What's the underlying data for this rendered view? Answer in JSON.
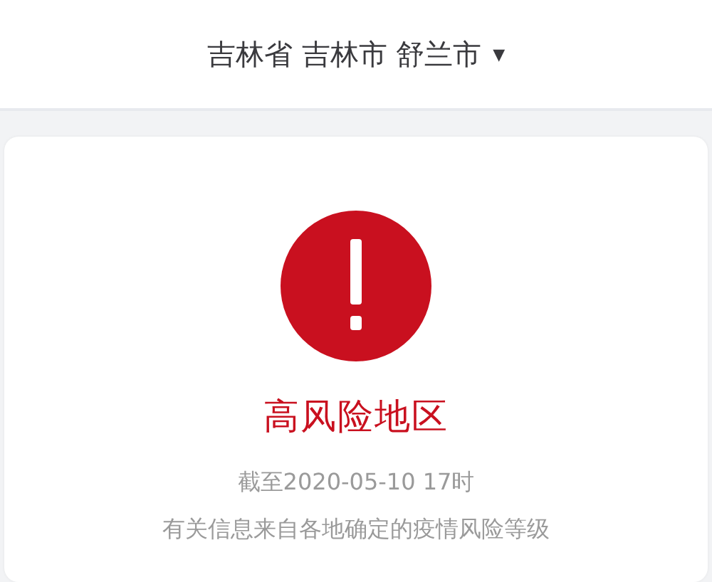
{
  "location_selector": {
    "label": "吉林省 吉林市 舒兰市",
    "caret": "▼"
  },
  "risk_card": {
    "color": "#c9101f",
    "title": "高风险地区",
    "as_of": "截至2020-05-10 17时",
    "note": "有关信息来自各地确定的疫情风险等级"
  }
}
